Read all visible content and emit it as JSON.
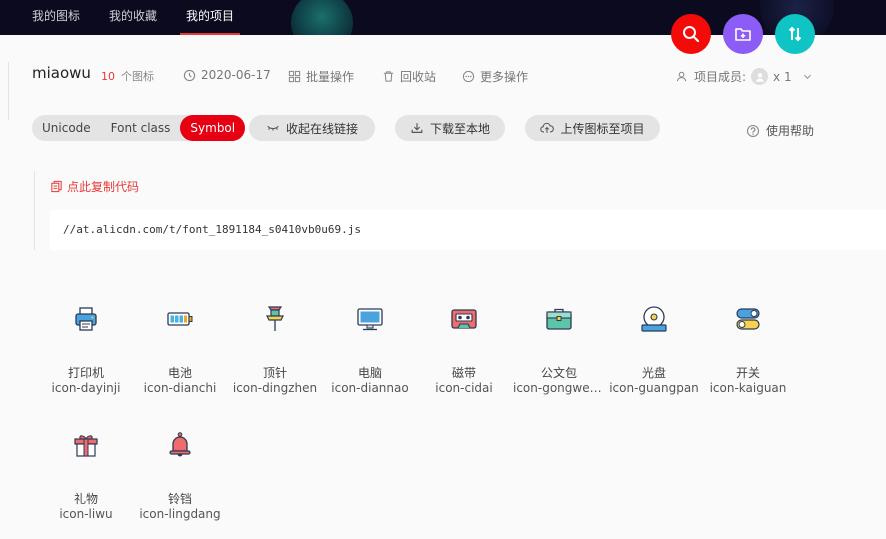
{
  "nav": {
    "items": [
      {
        "label": "我的图标"
      },
      {
        "label": "我的收藏"
      },
      {
        "label": "我的项目"
      }
    ]
  },
  "fabs": [
    {
      "icon": "search-icon",
      "color": "#f50a0a"
    },
    {
      "icon": "folder-plus-icon",
      "color": "#8b5cf6"
    },
    {
      "icon": "sort-updown-icon",
      "color": "#0fc4c4"
    }
  ],
  "project": {
    "name": "miaowu",
    "icon_count": "10",
    "icon_count_unit": "个图标",
    "date": "2020-06-17",
    "batch": "批量操作",
    "recycle": "回收站",
    "more": "更多操作",
    "members_label": "项目成员:",
    "members_count": "x 1"
  },
  "tabs": {
    "unicode": "Unicode",
    "fontclass": "Font class",
    "symbol": "Symbol"
  },
  "actions": {
    "collapse": "收起在线链接",
    "download": "下载至本地",
    "upload": "上传图标至项目",
    "help": "使用帮助"
  },
  "code": {
    "copy": "点此复制代码",
    "url": "//at.alicdn.com/t/font_1891184_s0410vb0u69.js"
  },
  "icons": [
    {
      "name": "打印机",
      "font": "icon-dayinji",
      "icon": "printer-icon"
    },
    {
      "name": "电池",
      "font": "icon-dianchi",
      "icon": "battery-icon"
    },
    {
      "name": "顶针",
      "font": "icon-dingzhen",
      "icon": "pushpin-icon"
    },
    {
      "name": "电脑",
      "font": "icon-diannao",
      "icon": "monitor-icon"
    },
    {
      "name": "磁带",
      "font": "icon-cidai",
      "icon": "cassette-icon"
    },
    {
      "name": "公文包",
      "font": "icon-gongwenbao",
      "icon": "briefcase-icon"
    },
    {
      "name": "光盘",
      "font": "icon-guangpan",
      "icon": "disc-icon"
    },
    {
      "name": "开关",
      "font": "icon-kaiguan",
      "icon": "toggle-switch-icon"
    },
    {
      "name": "礼物",
      "font": "icon-liwu",
      "icon": "gift-icon"
    },
    {
      "name": "铃铛",
      "font": "icon-lingdang",
      "icon": "bell-icon"
    }
  ]
}
